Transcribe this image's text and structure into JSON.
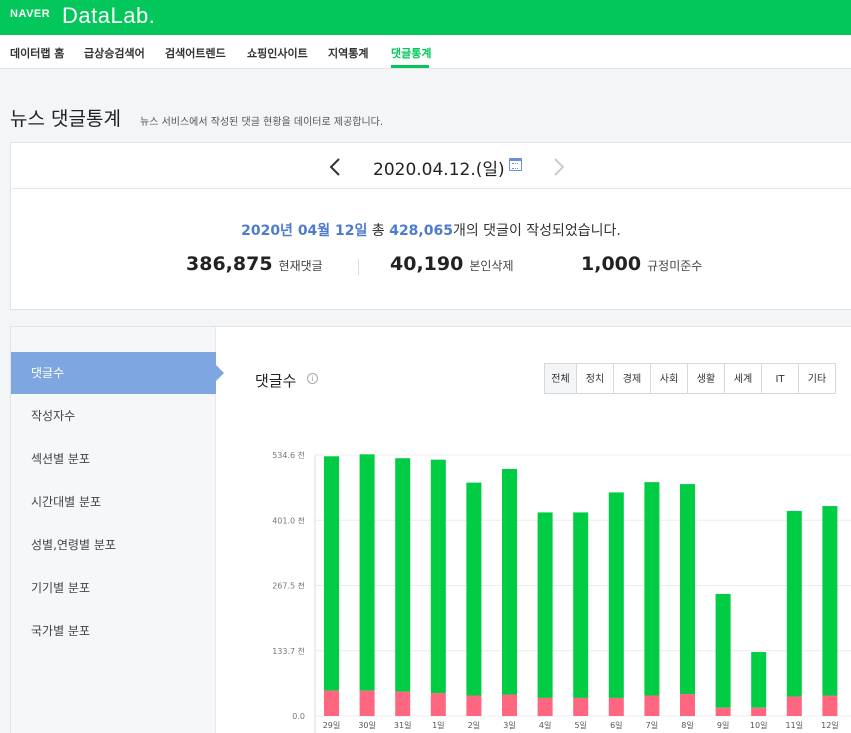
{
  "header": {
    "brand": "NAVER",
    "product": "DataLab."
  },
  "nav": {
    "items": [
      {
        "label": "데이터랩 홈",
        "active": false
      },
      {
        "label": "급상승검색어",
        "active": false
      },
      {
        "label": "검색어트렌드",
        "active": false
      },
      {
        "label": "쇼핑인사이트",
        "active": false
      },
      {
        "label": "지역통계",
        "active": false
      },
      {
        "label": "댓글통계",
        "active": true
      }
    ]
  },
  "page": {
    "title": "뉴스 댓글통계",
    "description": "뉴스 서비스에서 작성된 댓글 현황을 데이터로 제공합니다."
  },
  "summary": {
    "date": "2020.04.12.(일)",
    "prev_icon": "chevron-left-icon",
    "next_icon": "chevron-right-icon",
    "calendar_icon": "calendar-icon",
    "total_date": "2020년 04월 12일",
    "total_mid": " 총 ",
    "total_count": "428,065",
    "total_suffix": "개의 댓글이 작성되었습니다.",
    "stats": [
      {
        "value": "386,875",
        "label": "현재댓글"
      },
      {
        "value": "40,190",
        "label": "본인삭제"
      },
      {
        "value": "1,000",
        "label": "규정미준수"
      }
    ]
  },
  "sidebar": {
    "items": [
      {
        "label": "댓글수",
        "active": true
      },
      {
        "label": "작성자수",
        "active": false
      },
      {
        "label": "섹션별 분포",
        "active": false
      },
      {
        "label": "시간대별 분포",
        "active": false
      },
      {
        "label": "성별,연령별 분포",
        "active": false
      },
      {
        "label": "기기별 분포",
        "active": false
      },
      {
        "label": "국가별 분포",
        "active": false
      }
    ]
  },
  "chart_panel": {
    "title": "댓글수",
    "info_icon": "info-icon",
    "tabs": [
      "전체",
      "정치",
      "경제",
      "사회",
      "생활",
      "세계",
      "IT",
      "기타"
    ],
    "active_tab": "전체"
  },
  "colors": {
    "accent": "#03c75a",
    "link_blue": "#4e7ccc",
    "sidebar_active": "#7ea6e0",
    "bar_main": "#00cc44",
    "bar_deleted": "#ff6680"
  },
  "chart_data": {
    "type": "bar",
    "stacked": true,
    "y_ticks": [
      "0.0",
      "133.7 천",
      "267.5 천",
      "401.0 천",
      "534.6 천"
    ],
    "ylim": [
      0,
      534.6
    ],
    "categories": [
      "29일",
      "30일",
      "31일",
      "1일",
      "2일",
      "3일",
      "4일",
      "5일",
      "6일",
      "7일",
      "8일",
      "9일",
      "10일",
      "11일",
      "12일"
    ],
    "series": [
      {
        "values": [
          52,
          52,
          50,
          47,
          42,
          44,
          37,
          37,
          37,
          42,
          45,
          17,
          17,
          40,
          42
        ]
      },
      {
        "values": [
          480,
          484,
          478,
          478,
          436,
          462,
          380,
          380,
          421,
          437,
          430,
          233,
          114,
          380,
          388
        ]
      }
    ],
    "grid": true,
    "legend": "none"
  }
}
